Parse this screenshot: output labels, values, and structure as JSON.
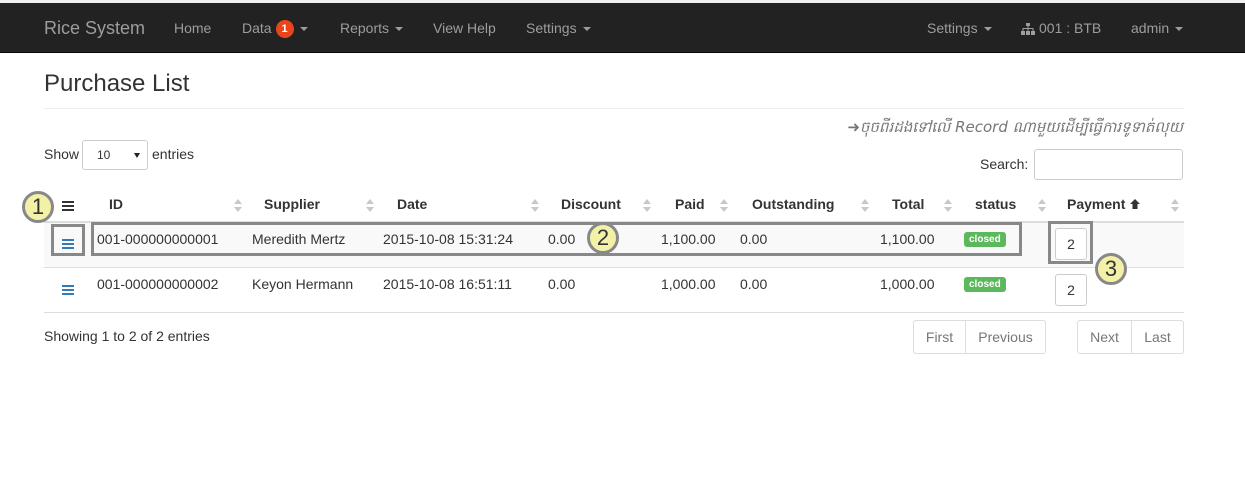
{
  "navbar": {
    "brand": "Rice System",
    "home": "Home",
    "data": "Data",
    "data_badge": "1",
    "reports": "Reports",
    "view_help": "View Help",
    "settings": "Settings",
    "right_settings": "Settings",
    "branch": "001 : BTB",
    "user": "admin"
  },
  "page": {
    "title": "Purchase List",
    "hint": "➜ចុចពីរដងទៅលើ Record ណាមួយដើម្បីធ្វើការទូទាត់លុយ"
  },
  "controls": {
    "show_label": "Show",
    "page_size": "10",
    "entries_label": "entries",
    "search_label": "Search:",
    "search_value": ""
  },
  "table": {
    "columns": [
      "ID",
      "Supplier",
      "Date",
      "Discount",
      "Paid",
      "Outstanding",
      "Total",
      "status",
      "Payment"
    ],
    "rows": [
      {
        "id": "001-000000000001",
        "supplier": "Meredith Mertz",
        "date": "2015-10-08 15:31:24",
        "discount": "0.00",
        "paid": "1,100.00",
        "outstanding": "0.00",
        "total": "1,100.00",
        "status": "closed",
        "payment": "2"
      },
      {
        "id": "001-000000000002",
        "supplier": "Keyon Hermann",
        "date": "2015-10-08 16:51:11",
        "discount": "0.00",
        "paid": "1,000.00",
        "outstanding": "0.00",
        "total": "1,000.00",
        "status": "closed",
        "payment": "2"
      }
    ]
  },
  "footer": {
    "info": "Showing 1 to 2 of 2 entries",
    "first": "First",
    "previous": "Previous",
    "next": "Next",
    "last": "Last"
  },
  "annotations": {
    "callout1": "1",
    "callout2": "2",
    "callout3": "3"
  },
  "colors": {
    "navbar": "#222222",
    "accent": "#337ab7",
    "badge": "#e8451c",
    "success": "#5cb85c",
    "callout": "#f3f0a8"
  }
}
